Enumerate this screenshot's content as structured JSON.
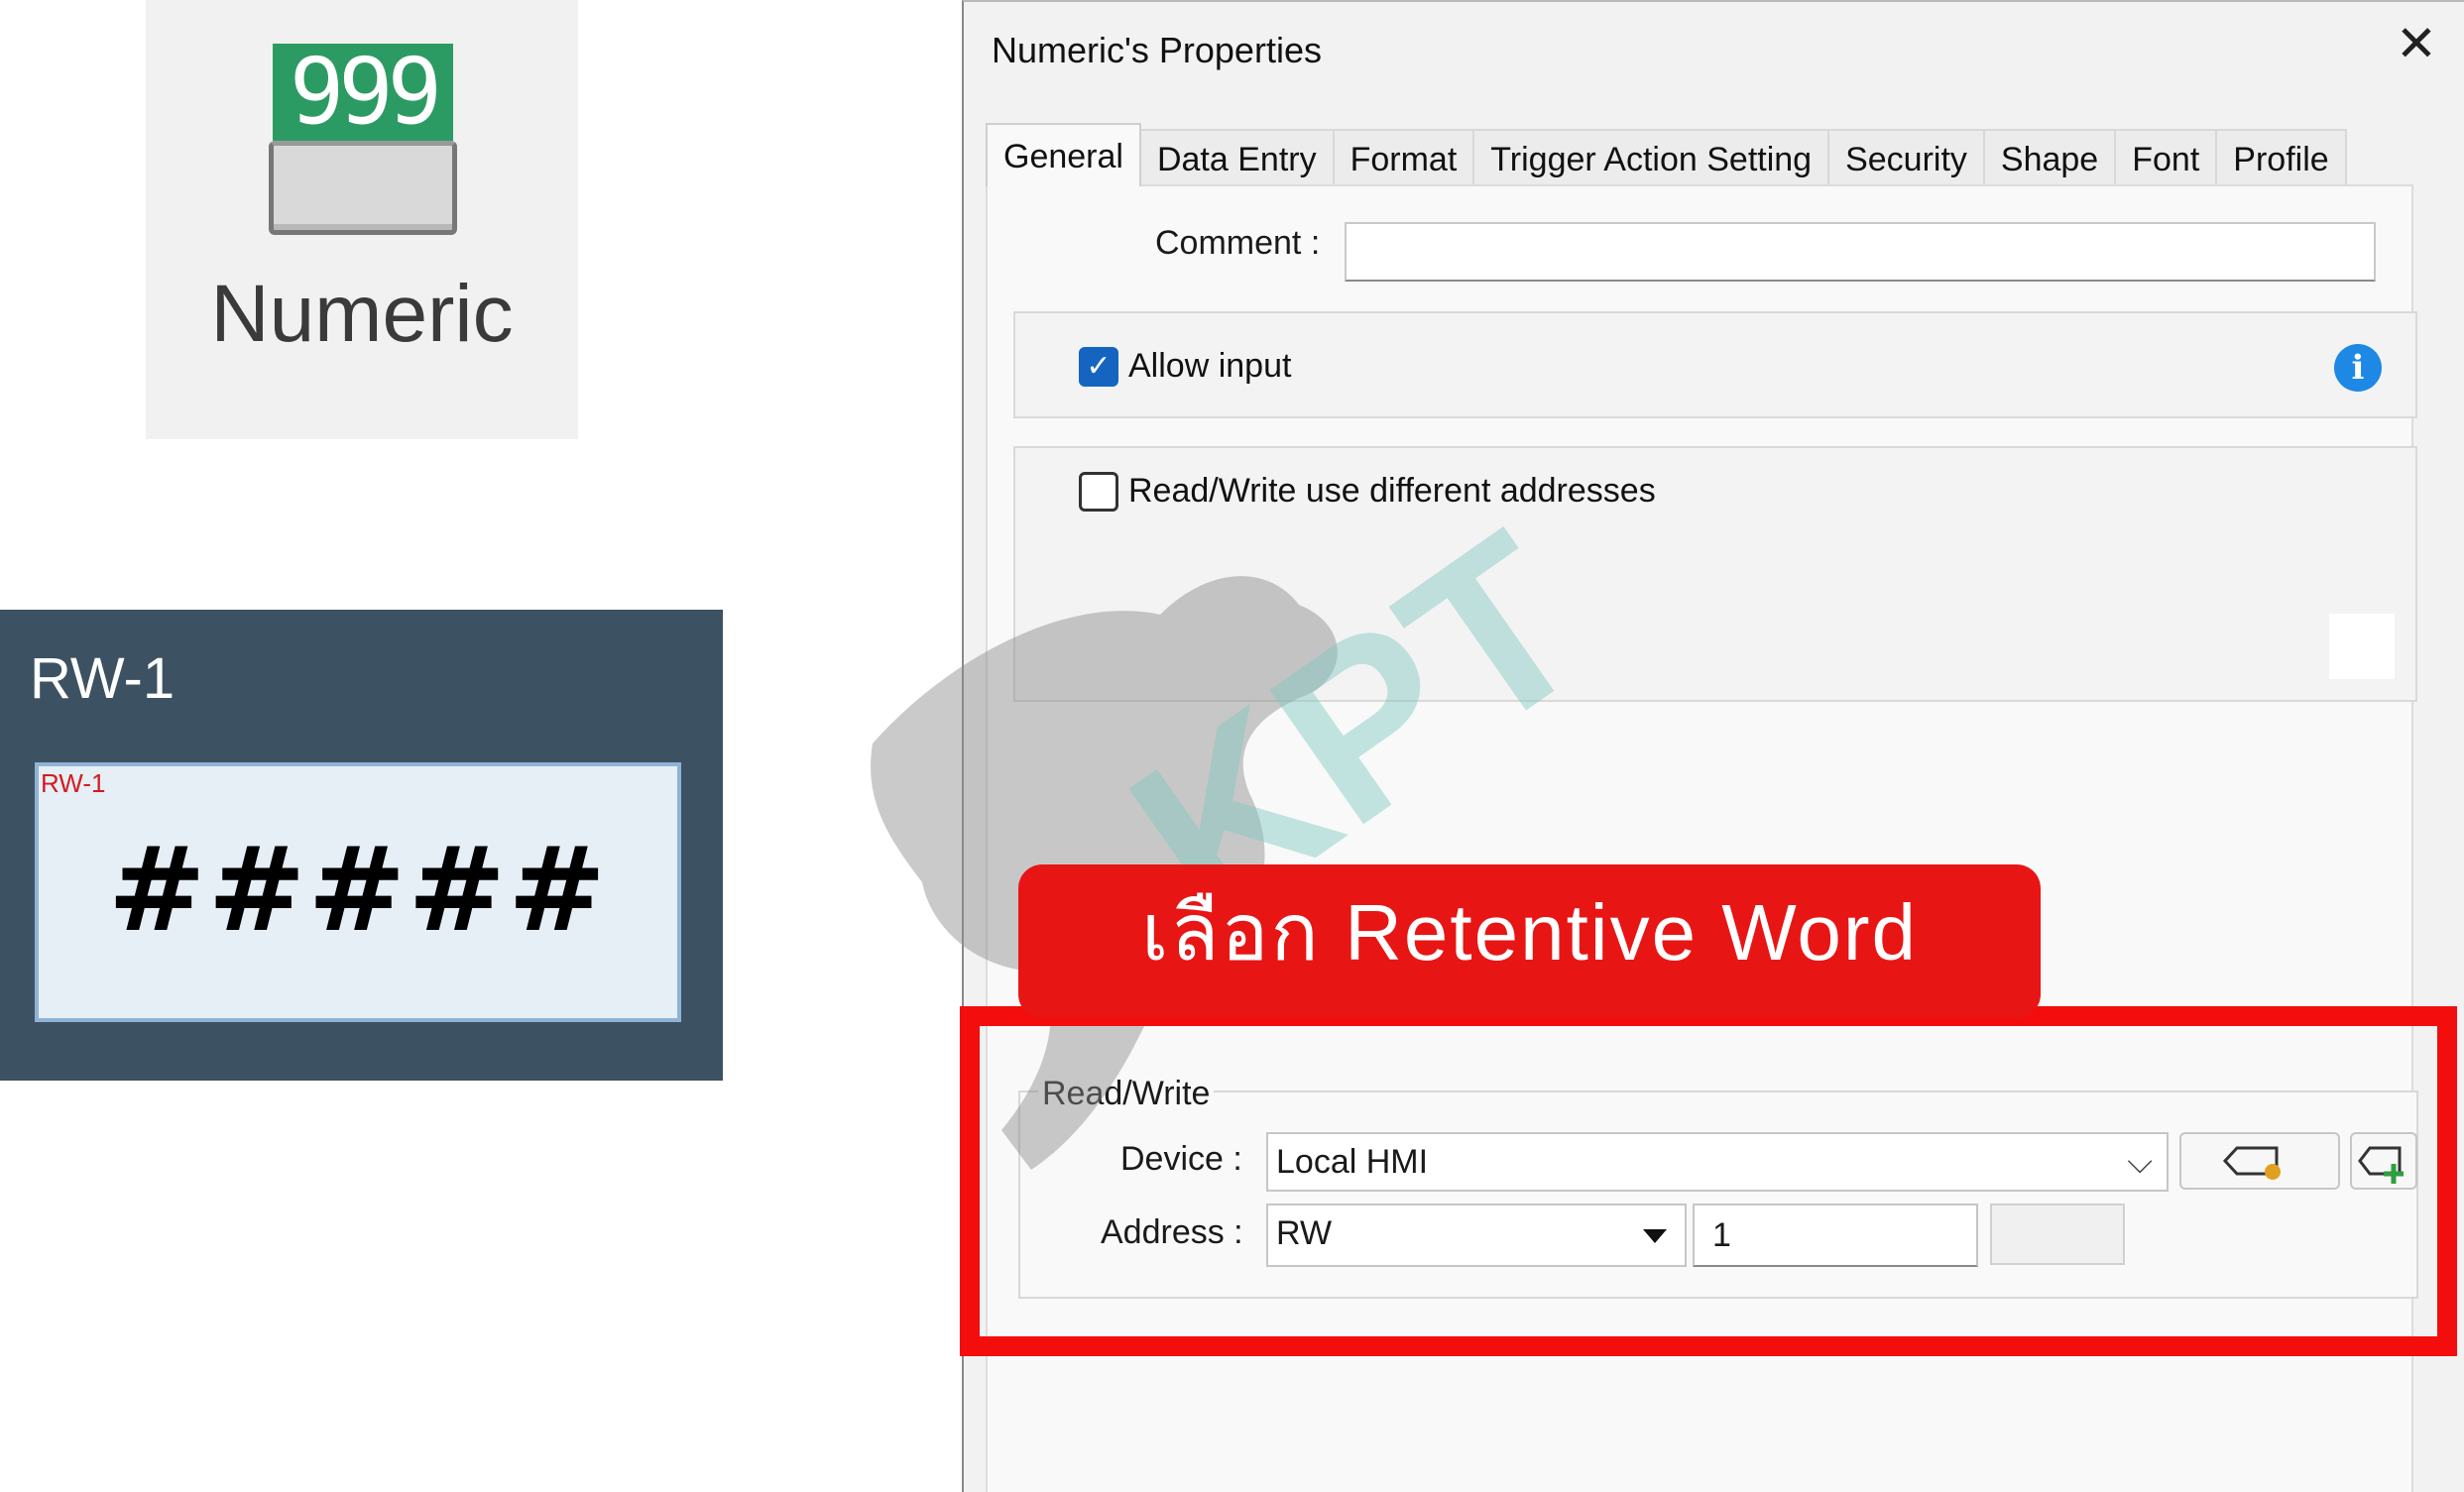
{
  "toolbox": {
    "numeric_tool": {
      "digits": "999",
      "label": "Numeric"
    }
  },
  "preview": {
    "title": "RW-1",
    "tag": "RW-1",
    "display": "#####"
  },
  "dialog": {
    "title": "Numeric's Properties",
    "close_icon": "close-icon",
    "tabs": [
      {
        "label": "General",
        "active": true
      },
      {
        "label": "Data Entry"
      },
      {
        "label": "Format"
      },
      {
        "label": "Trigger Action Setting"
      },
      {
        "label": "Security"
      },
      {
        "label": "Shape"
      },
      {
        "label": "Font"
      },
      {
        "label": "Profile"
      }
    ],
    "general": {
      "comment_label": "Comment :",
      "comment_value": "",
      "allow_input": {
        "label": "Allow input",
        "checked": true
      },
      "info_icon": "info-icon",
      "rw_different": {
        "label": "Read/Write use different addresses",
        "checked": false
      },
      "read_write": {
        "legend": "Read/Write",
        "device_label": "Device :",
        "device_value": "Local HMI",
        "address_label": "Address :",
        "address_type": "RW",
        "address_value": "1"
      }
    }
  },
  "annotation": {
    "callout_text": "เลือก Retentive Word",
    "accent_color": "#e81515"
  },
  "watermark": {
    "text": "KPT"
  }
}
